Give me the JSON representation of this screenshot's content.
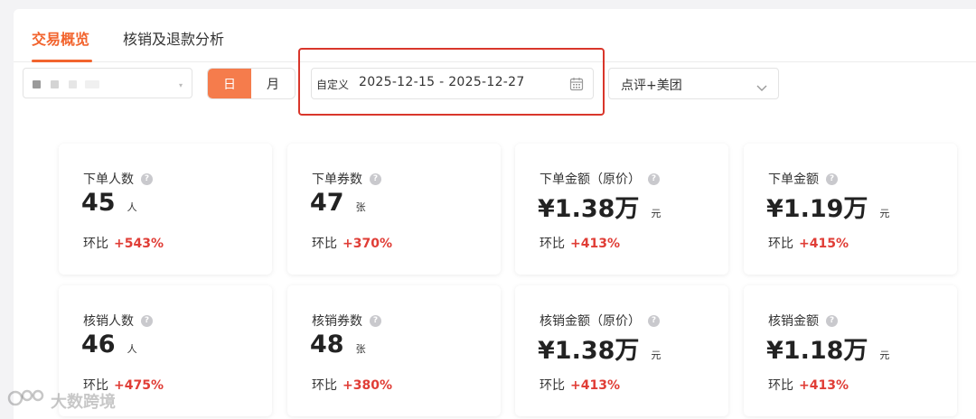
{
  "tabs": [
    {
      "label": "交易概览",
      "active": true
    },
    {
      "label": "核销及退款分析",
      "active": false
    }
  ],
  "segment": {
    "day_label": "日",
    "month_label": "月",
    "selected": "日"
  },
  "date_range": {
    "prefix": "自定义",
    "value": "2025-12-15 - 2025-12-27"
  },
  "platform": {
    "value": "点评+美团"
  },
  "change_label": "环比",
  "cards": [
    {
      "label": "下单人数",
      "value": "45",
      "unit": "人",
      "change": "+543%"
    },
    {
      "label": "下单券数",
      "value": "47",
      "unit": "张",
      "change": "+370%"
    },
    {
      "label": "下单金额（原价）",
      "value": "¥1.38万",
      "unit": "元",
      "change": "+413%"
    },
    {
      "label": "下单金额",
      "value": "¥1.19万",
      "unit": "元",
      "change": "+415%"
    },
    {
      "label": "核销人数",
      "value": "46",
      "unit": "人",
      "change": "+475%"
    },
    {
      "label": "核销券数",
      "value": "48",
      "unit": "张",
      "change": "+380%"
    },
    {
      "label": "核销金额（原价）",
      "value": "¥1.38万",
      "unit": "元",
      "change": "+413%"
    },
    {
      "label": "核销金额",
      "value": "¥1.18万",
      "unit": "元",
      "change": "+413%"
    }
  ],
  "watermark": {
    "text": "大数跨境"
  },
  "colors": {
    "accent": "#f2642e",
    "positive": "#e03d36",
    "highlight": "#d9362b"
  }
}
